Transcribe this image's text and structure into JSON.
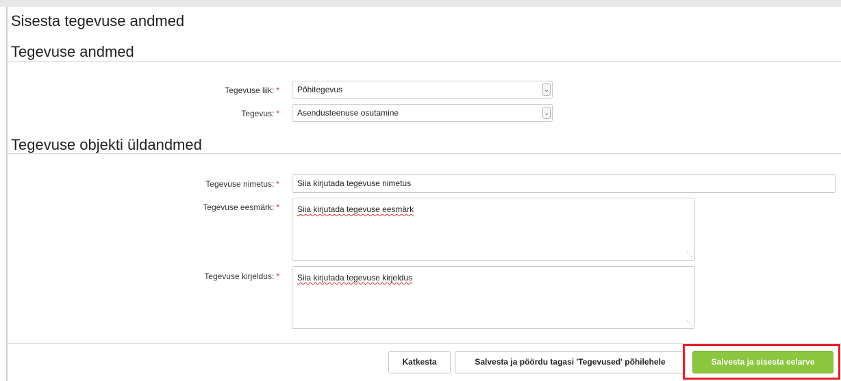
{
  "page": {
    "title": "Sisesta tegevuse andmed"
  },
  "sections": [
    {
      "title": "Tegevuse andmed"
    },
    {
      "title": "Tegevuse objekti üldandmed"
    }
  ],
  "fields": {
    "tegevuse_liik": {
      "label": "Tegevuse liik:",
      "required_mark": "*",
      "value": "Põhitegevus"
    },
    "tegevus": {
      "label": "Tegevus:",
      "required_mark": "*",
      "value": "Asendusteenuse osutamine"
    },
    "tegevuse_nimetus": {
      "label": "Tegevuse nimetus:",
      "required_mark": "*",
      "value": "Siia kirjutada tegevuse nimetus"
    },
    "tegevuse_eesmark": {
      "label": "Tegevuse eesmärk:",
      "required_mark": "*",
      "value": "Siia kirjutada tegevuse eesmärk"
    },
    "tegevuse_kirjeldus": {
      "label": "Tegevuse kirjeldus:",
      "required_mark": "*",
      "value": "Siia kirjutada tegevuse kirjeldus"
    }
  },
  "buttons": {
    "cancel": "Katkesta",
    "save_back": "Salvesta ja pöördu tagasi 'Tegevused' põhilehele",
    "save_budget": "Salvesta ja sisesta eelarve"
  },
  "icons": {
    "select_arrow": "chevron-down-icon",
    "resize": "resize-grip-icon"
  },
  "colors": {
    "primary": "#8cc63f",
    "required": "#d9342b",
    "highlight": "#e3202a"
  }
}
